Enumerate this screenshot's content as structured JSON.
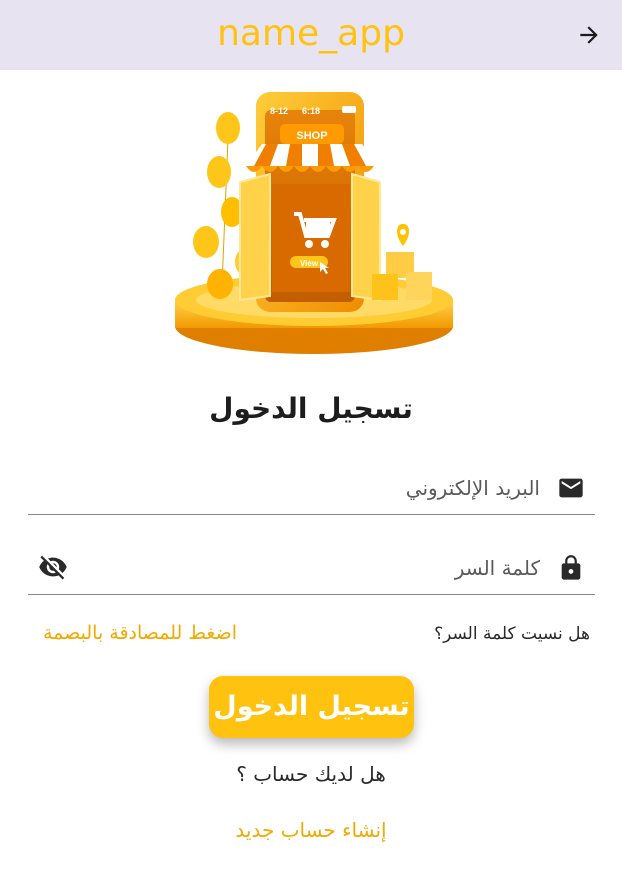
{
  "app_bar": {
    "title": "name_app",
    "back_icon": "arrow-forward-icon"
  },
  "hero": {
    "illustration": "shop-phone-illustration",
    "shop_sign": "SHOP",
    "phone_status_left": "8-12",
    "phone_status_time": "6:18",
    "view_label": "View"
  },
  "login": {
    "heading": "تسجيل الدخول",
    "email_label": "البريد الإلكتروني",
    "email_icon": "email-icon",
    "password_label": "كلمة السر",
    "password_icon": "lock-icon",
    "visibility_icon": "visibility-off-icon",
    "forgot_password": "هل نسيت كلمة السر؟",
    "fingerprint_login": "اضغط للمصادقة بالبصمة",
    "submit_label": "تسجيل الدخول",
    "no_account": "هل لديك حساب ؟",
    "create_account": "إنشاء حساب جديد"
  },
  "colors": {
    "accent": "#ffc20e",
    "link": "#f2a900",
    "app_bar_bg": "#e8e3f1"
  }
}
